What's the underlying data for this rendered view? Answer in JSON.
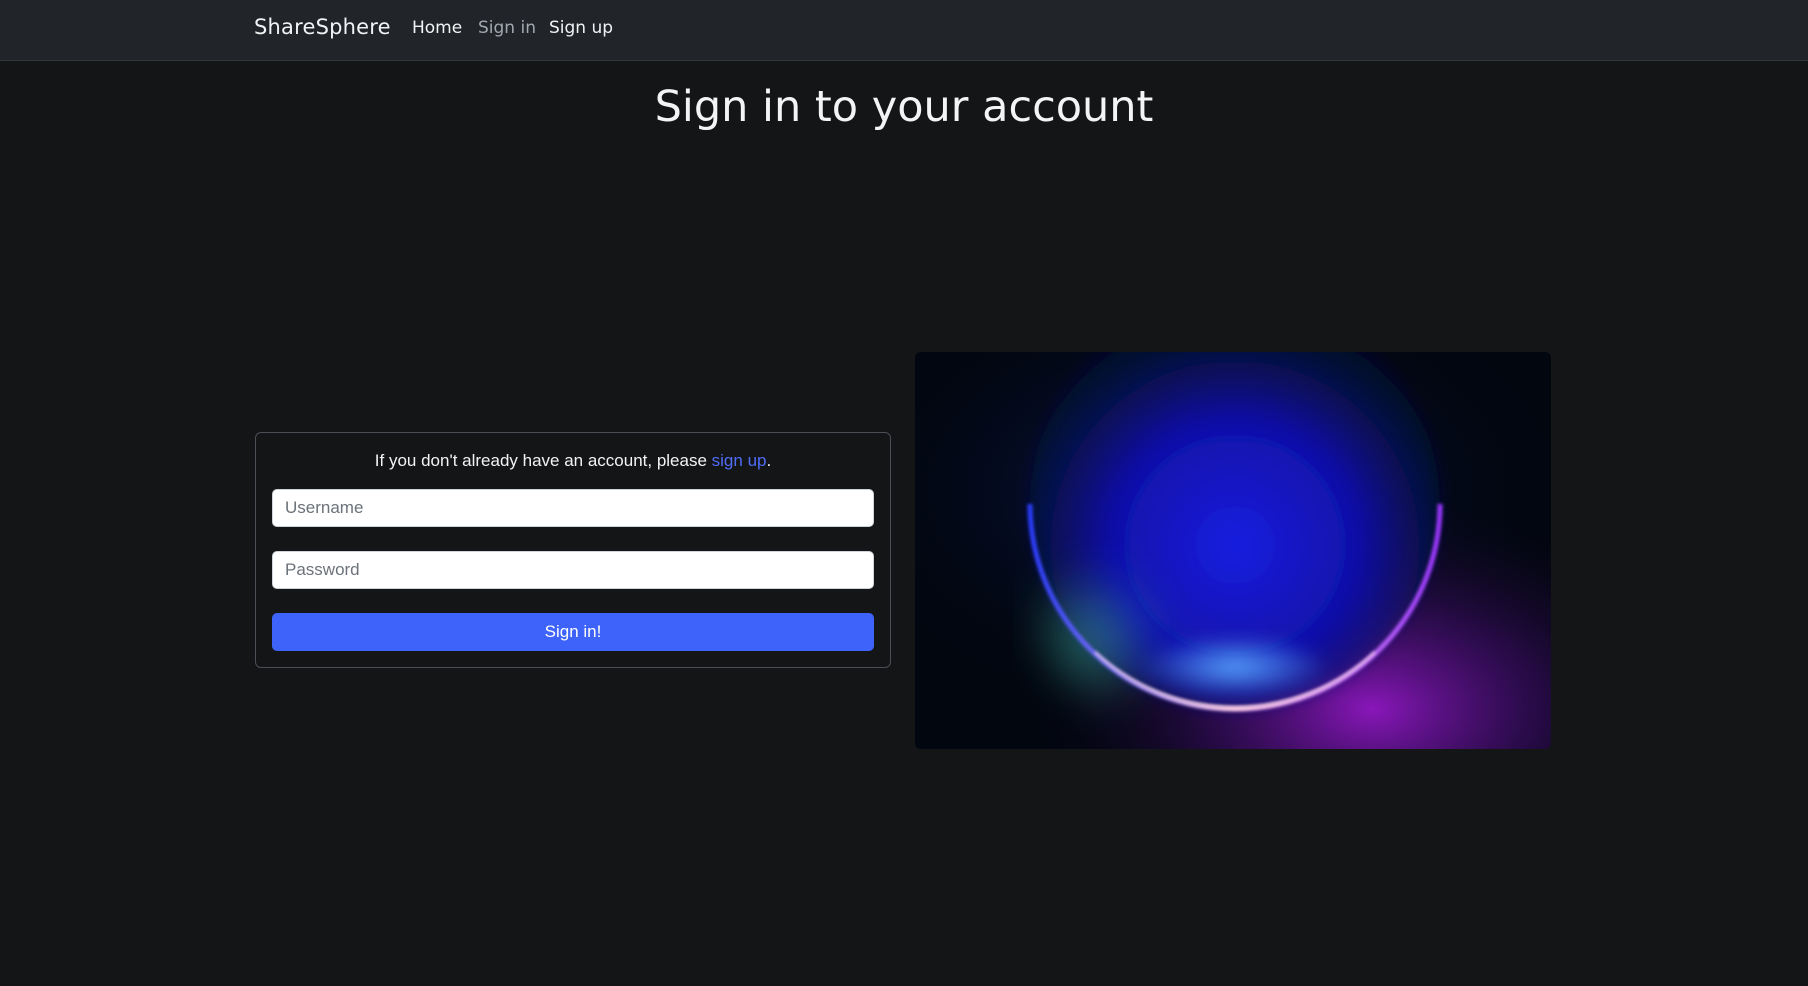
{
  "navbar": {
    "brand": "ShareSphere",
    "links": [
      {
        "label": "Home",
        "active": false
      },
      {
        "label": "Sign in",
        "active": true
      },
      {
        "label": "Sign up",
        "active": false
      }
    ]
  },
  "main": {
    "title": "Sign in to your account",
    "signin_card": {
      "prompt_prefix": "If you don't already have an account, please ",
      "prompt_link": "sign up",
      "prompt_suffix": ".",
      "username_placeholder": "Username",
      "password_placeholder": "Password",
      "submit_label": "Sign in!"
    },
    "hero_image": {
      "icon": "glowing-sphere-illustration"
    }
  },
  "colors": {
    "navbar_bg": "#212429",
    "page_bg": "#141517",
    "accent": "#3d63fb",
    "link": "#4f6cf7"
  }
}
